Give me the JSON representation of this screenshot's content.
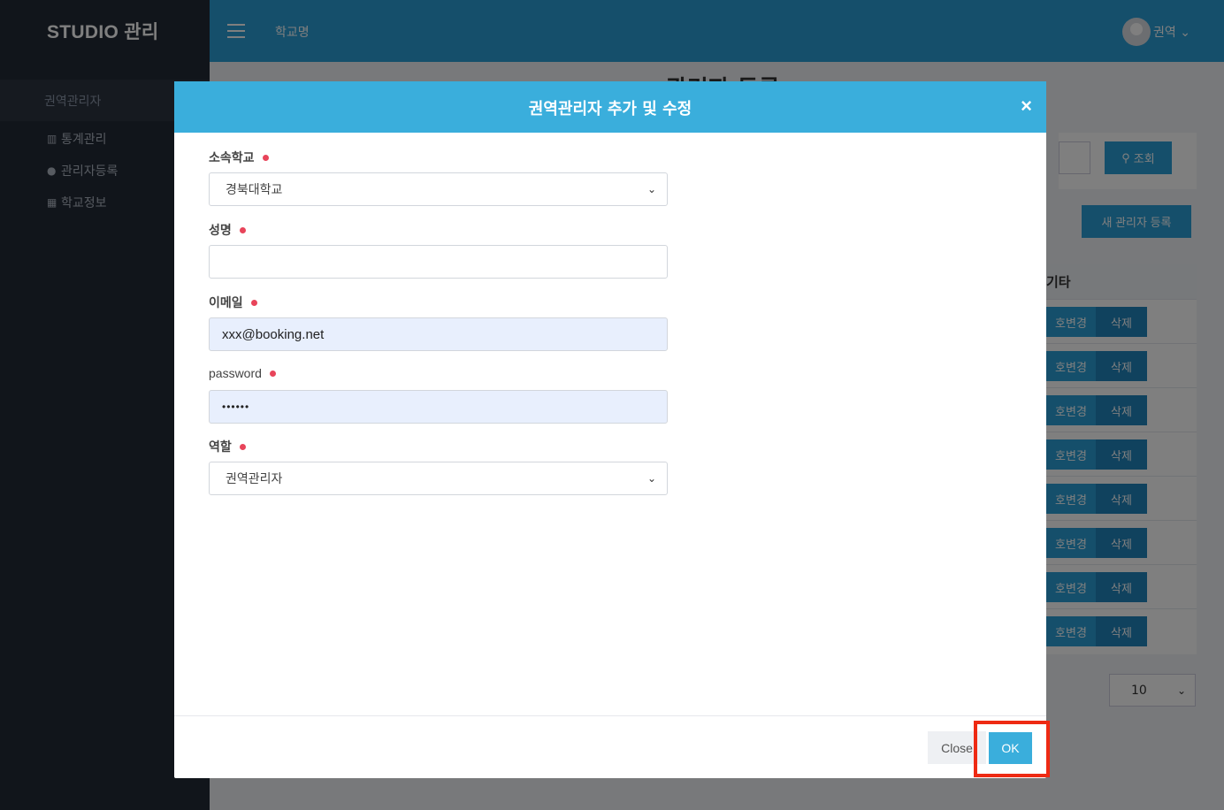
{
  "app": {
    "brand": "STUDIO 관리",
    "top_title": "학교명",
    "user_name": "권역 ⌄",
    "sidebar": {
      "section": "권역관리자",
      "items": [
        {
          "icon": "bar-chart-icon",
          "glyph": "📊",
          "label": "통계관리"
        },
        {
          "icon": "user-icon",
          "glyph": "👤",
          "label": "관리자등록"
        },
        {
          "icon": "building-icon",
          "glyph": "▦",
          "label": "학교정보"
        }
      ]
    },
    "page_title": "관리자 등록",
    "search_button": "조회",
    "new_button": "새 관리자 등록",
    "table_header": "기타",
    "row_actions": {
      "change": "호변경",
      "delete": "삭제"
    },
    "row_count": 8,
    "page_size": "10"
  },
  "modal": {
    "title": "권역관리자 추가 및 수정",
    "close_glyph": "×",
    "fields": {
      "school": {
        "label": "소속학교",
        "value": "경북대학교"
      },
      "name": {
        "label": "성명",
        "value": ""
      },
      "email": {
        "label": "이메일",
        "value": "xxx@booking.net"
      },
      "password": {
        "label": "password",
        "value": "••••••"
      },
      "role": {
        "label": "역할",
        "value": "권역관리자"
      }
    },
    "buttons": {
      "close": "Close",
      "ok": "OK"
    }
  },
  "colors": {
    "header_blue": "#3aaedc",
    "topbar_blue": "#2a9fd6",
    "sidebar_dark": "#232a36",
    "required_dot": "#e8445a",
    "highlight_red": "#ee2a13"
  }
}
